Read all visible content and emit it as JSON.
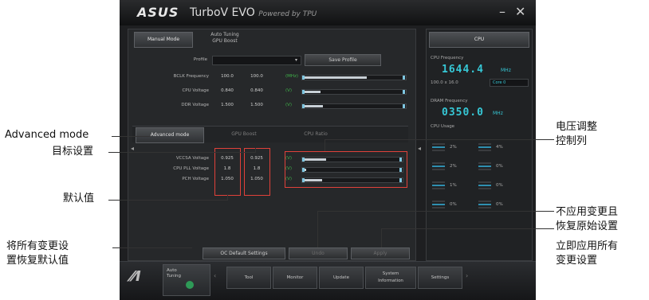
{
  "app": {
    "brand": "ASUS",
    "title": "TurboV EVO",
    "powered_by": "Powered by TPU",
    "minimize": "–",
    "close": "✕"
  },
  "mode_tabs": {
    "manual": "Manual Mode",
    "auto_tuning": "Auto Tuning\nGPU Boost"
  },
  "profile": {
    "label": "Profile",
    "selected": "",
    "save_button": "Save Profile"
  },
  "main_rows": [
    {
      "label": "BCLK Frequency",
      "current": "100.0",
      "target": "100.0",
      "unit": "(MHz)",
      "level": 0.62
    },
    {
      "label": "CPU Voltage",
      "current": "0.840",
      "target": "0.840",
      "unit": "(V)",
      "level": 0.18
    },
    {
      "label": "DDR Voltage",
      "current": "1.500",
      "target": "1.500",
      "unit": "(V)",
      "level": 0.2
    }
  ],
  "sub_tabs": [
    "Advanced mode",
    "GPU Boost",
    "CPU Ratio"
  ],
  "advanced_rows": [
    {
      "label": "VCCSA Voltage",
      "current": "0.925",
      "target": "0.925",
      "unit": "(V)",
      "level": 0.24
    },
    {
      "label": "CPU PLL Voltage",
      "current": "1.8",
      "target": "1.8",
      "unit": "(V)",
      "level": 0.04
    },
    {
      "label": "PCH Voltage",
      "current": "1.050",
      "target": "1.050",
      "unit": "(V)",
      "level": 0.2
    }
  ],
  "bottom_buttons": {
    "default_settings": "OC Default Settings",
    "undo": "Undo",
    "apply": "Apply"
  },
  "right_panel": {
    "header": "CPU",
    "cpu_freq_label": "CPU Frequency",
    "cpu_freq_value": "1644.4",
    "cpu_freq_unit": "MHz",
    "cpu_freq_detail": "100.0 x 16.0",
    "core_selector": "Core 0",
    "dram_freq_label": "DRAM Frequency",
    "dram_freq_value": "0350.0",
    "dram_freq_unit": "MHz",
    "usage_label": "CPU Usage",
    "usage": [
      {
        "left": "2%",
        "right": "4%"
      },
      {
        "left": "2%",
        "right": "0%"
      },
      {
        "left": "1%",
        "right": "0%"
      },
      {
        "left": "0%",
        "right": "0%"
      }
    ]
  },
  "taskbar": {
    "auto_tuning": "Auto\nTuning",
    "tool": "Tool",
    "monitor": "Monitor",
    "update": "Update",
    "system_info": "System\nInformation",
    "settings": "Settings"
  },
  "annotations": {
    "advanced_mode": "Advanced mode",
    "target_settings": "目标设置",
    "default_value": "默认值",
    "reset_all_line1": "将所有变更设",
    "reset_all_line2": "置恢复默认值",
    "voltage_adjust_line1": "电压调整",
    "voltage_adjust_line2": "控制列",
    "undo_line1": "不应用变更且",
    "undo_line2": "恢复原始设置",
    "apply_line1": "立即应用所有",
    "apply_line2": "变更设置"
  }
}
